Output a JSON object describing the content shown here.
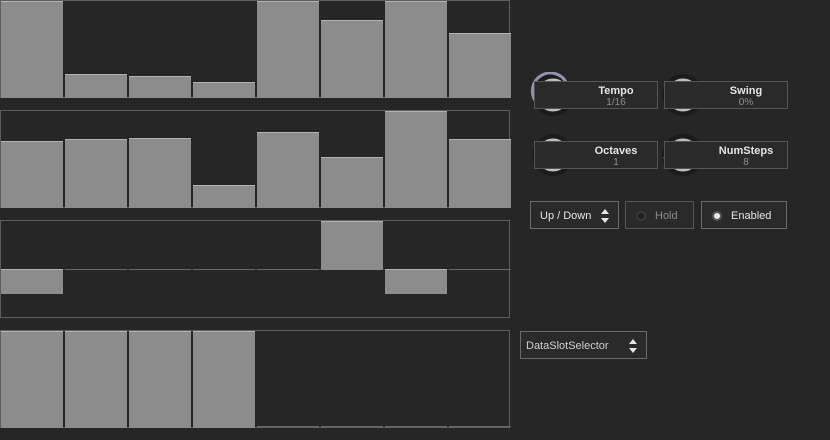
{
  "sequencer": {
    "row1": {
      "steps": [
        1.0,
        0.24,
        0.22,
        0.16,
        1.0,
        0.8,
        1.0,
        0.67
      ]
    },
    "row2": {
      "steps": [
        0.69,
        0.71,
        0.72,
        0.23,
        0.78,
        0.52,
        1.0,
        0.71
      ]
    },
    "row3": {
      "steps": [
        -0.5,
        0,
        0,
        0,
        0,
        1.0,
        -0.5,
        0
      ]
    },
    "row4": {
      "steps": [
        1.0,
        1.0,
        1.0,
        1.0,
        0,
        0,
        0,
        0
      ]
    }
  },
  "controls": {
    "tempo": {
      "label": "Tempo",
      "value": "1/16"
    },
    "swing": {
      "label": "Swing",
      "value": "0%"
    },
    "octaves": {
      "label": "Octaves",
      "value": "1"
    },
    "numsteps": {
      "label": "NumSteps",
      "value": "8"
    },
    "mode": {
      "label": "Up / Down"
    },
    "hold": {
      "label": "Hold",
      "active": false
    },
    "enabled": {
      "label": "Enabled",
      "active": true
    }
  },
  "data_slot_selector": {
    "label": "DataSlotSelector"
  },
  "colors": {
    "background": "#262626",
    "bar": "#8c8c8c",
    "knob_track": "#1a1a1a",
    "knob_ring": "#b9b9b9",
    "knob_arc": "#9aa0b8"
  },
  "icons": [
    "up-down-arrows-icon",
    "radio-dot-icon",
    "knob-icon"
  ]
}
